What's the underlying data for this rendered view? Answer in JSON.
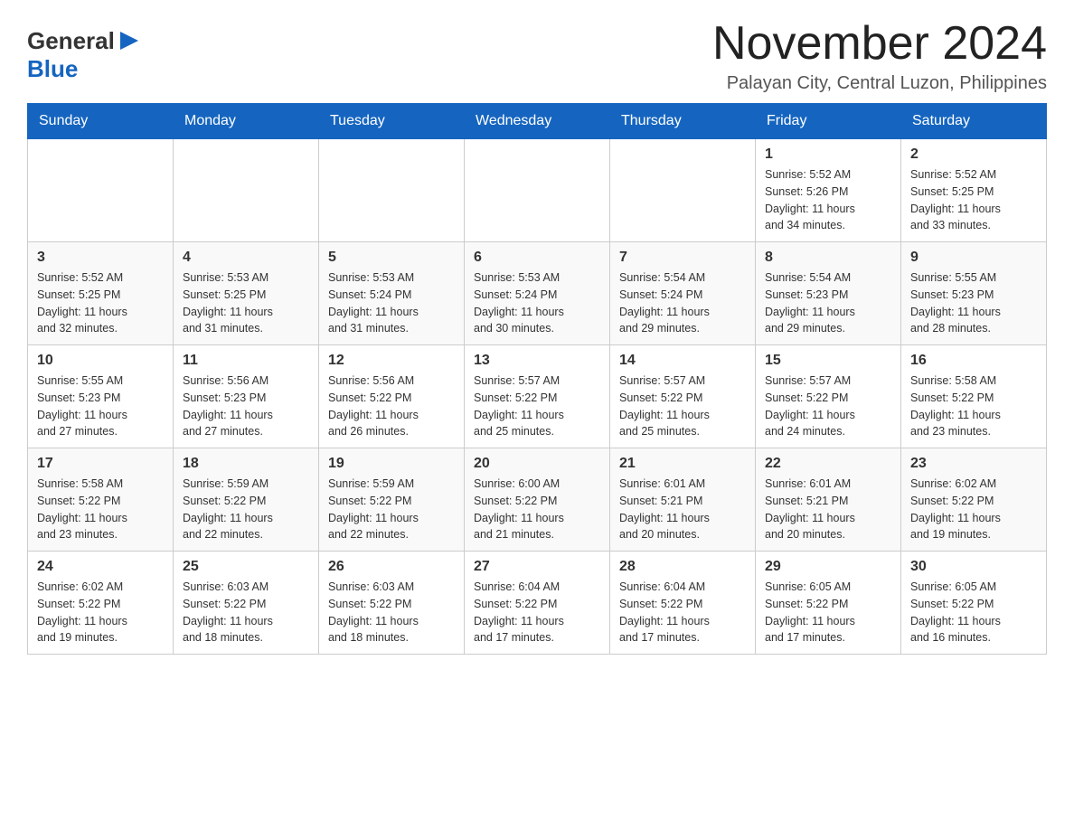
{
  "header": {
    "logo_general": "General",
    "logo_blue": "Blue",
    "month_title": "November 2024",
    "location": "Palayan City, Central Luzon, Philippines"
  },
  "weekdays": [
    "Sunday",
    "Monday",
    "Tuesday",
    "Wednesday",
    "Thursday",
    "Friday",
    "Saturday"
  ],
  "weeks": [
    [
      {
        "day": "",
        "info": ""
      },
      {
        "day": "",
        "info": ""
      },
      {
        "day": "",
        "info": ""
      },
      {
        "day": "",
        "info": ""
      },
      {
        "day": "",
        "info": ""
      },
      {
        "day": "1",
        "info": "Sunrise: 5:52 AM\nSunset: 5:26 PM\nDaylight: 11 hours\nand 34 minutes."
      },
      {
        "day": "2",
        "info": "Sunrise: 5:52 AM\nSunset: 5:25 PM\nDaylight: 11 hours\nand 33 minutes."
      }
    ],
    [
      {
        "day": "3",
        "info": "Sunrise: 5:52 AM\nSunset: 5:25 PM\nDaylight: 11 hours\nand 32 minutes."
      },
      {
        "day": "4",
        "info": "Sunrise: 5:53 AM\nSunset: 5:25 PM\nDaylight: 11 hours\nand 31 minutes."
      },
      {
        "day": "5",
        "info": "Sunrise: 5:53 AM\nSunset: 5:24 PM\nDaylight: 11 hours\nand 31 minutes."
      },
      {
        "day": "6",
        "info": "Sunrise: 5:53 AM\nSunset: 5:24 PM\nDaylight: 11 hours\nand 30 minutes."
      },
      {
        "day": "7",
        "info": "Sunrise: 5:54 AM\nSunset: 5:24 PM\nDaylight: 11 hours\nand 29 minutes."
      },
      {
        "day": "8",
        "info": "Sunrise: 5:54 AM\nSunset: 5:23 PM\nDaylight: 11 hours\nand 29 minutes."
      },
      {
        "day": "9",
        "info": "Sunrise: 5:55 AM\nSunset: 5:23 PM\nDaylight: 11 hours\nand 28 minutes."
      }
    ],
    [
      {
        "day": "10",
        "info": "Sunrise: 5:55 AM\nSunset: 5:23 PM\nDaylight: 11 hours\nand 27 minutes."
      },
      {
        "day": "11",
        "info": "Sunrise: 5:56 AM\nSunset: 5:23 PM\nDaylight: 11 hours\nand 27 minutes."
      },
      {
        "day": "12",
        "info": "Sunrise: 5:56 AM\nSunset: 5:22 PM\nDaylight: 11 hours\nand 26 minutes."
      },
      {
        "day": "13",
        "info": "Sunrise: 5:57 AM\nSunset: 5:22 PM\nDaylight: 11 hours\nand 25 minutes."
      },
      {
        "day": "14",
        "info": "Sunrise: 5:57 AM\nSunset: 5:22 PM\nDaylight: 11 hours\nand 25 minutes."
      },
      {
        "day": "15",
        "info": "Sunrise: 5:57 AM\nSunset: 5:22 PM\nDaylight: 11 hours\nand 24 minutes."
      },
      {
        "day": "16",
        "info": "Sunrise: 5:58 AM\nSunset: 5:22 PM\nDaylight: 11 hours\nand 23 minutes."
      }
    ],
    [
      {
        "day": "17",
        "info": "Sunrise: 5:58 AM\nSunset: 5:22 PM\nDaylight: 11 hours\nand 23 minutes."
      },
      {
        "day": "18",
        "info": "Sunrise: 5:59 AM\nSunset: 5:22 PM\nDaylight: 11 hours\nand 22 minutes."
      },
      {
        "day": "19",
        "info": "Sunrise: 5:59 AM\nSunset: 5:22 PM\nDaylight: 11 hours\nand 22 minutes."
      },
      {
        "day": "20",
        "info": "Sunrise: 6:00 AM\nSunset: 5:22 PM\nDaylight: 11 hours\nand 21 minutes."
      },
      {
        "day": "21",
        "info": "Sunrise: 6:01 AM\nSunset: 5:21 PM\nDaylight: 11 hours\nand 20 minutes."
      },
      {
        "day": "22",
        "info": "Sunrise: 6:01 AM\nSunset: 5:21 PM\nDaylight: 11 hours\nand 20 minutes."
      },
      {
        "day": "23",
        "info": "Sunrise: 6:02 AM\nSunset: 5:22 PM\nDaylight: 11 hours\nand 19 minutes."
      }
    ],
    [
      {
        "day": "24",
        "info": "Sunrise: 6:02 AM\nSunset: 5:22 PM\nDaylight: 11 hours\nand 19 minutes."
      },
      {
        "day": "25",
        "info": "Sunrise: 6:03 AM\nSunset: 5:22 PM\nDaylight: 11 hours\nand 18 minutes."
      },
      {
        "day": "26",
        "info": "Sunrise: 6:03 AM\nSunset: 5:22 PM\nDaylight: 11 hours\nand 18 minutes."
      },
      {
        "day": "27",
        "info": "Sunrise: 6:04 AM\nSunset: 5:22 PM\nDaylight: 11 hours\nand 17 minutes."
      },
      {
        "day": "28",
        "info": "Sunrise: 6:04 AM\nSunset: 5:22 PM\nDaylight: 11 hours\nand 17 minutes."
      },
      {
        "day": "29",
        "info": "Sunrise: 6:05 AM\nSunset: 5:22 PM\nDaylight: 11 hours\nand 17 minutes."
      },
      {
        "day": "30",
        "info": "Sunrise: 6:05 AM\nSunset: 5:22 PM\nDaylight: 11 hours\nand 16 minutes."
      }
    ]
  ]
}
